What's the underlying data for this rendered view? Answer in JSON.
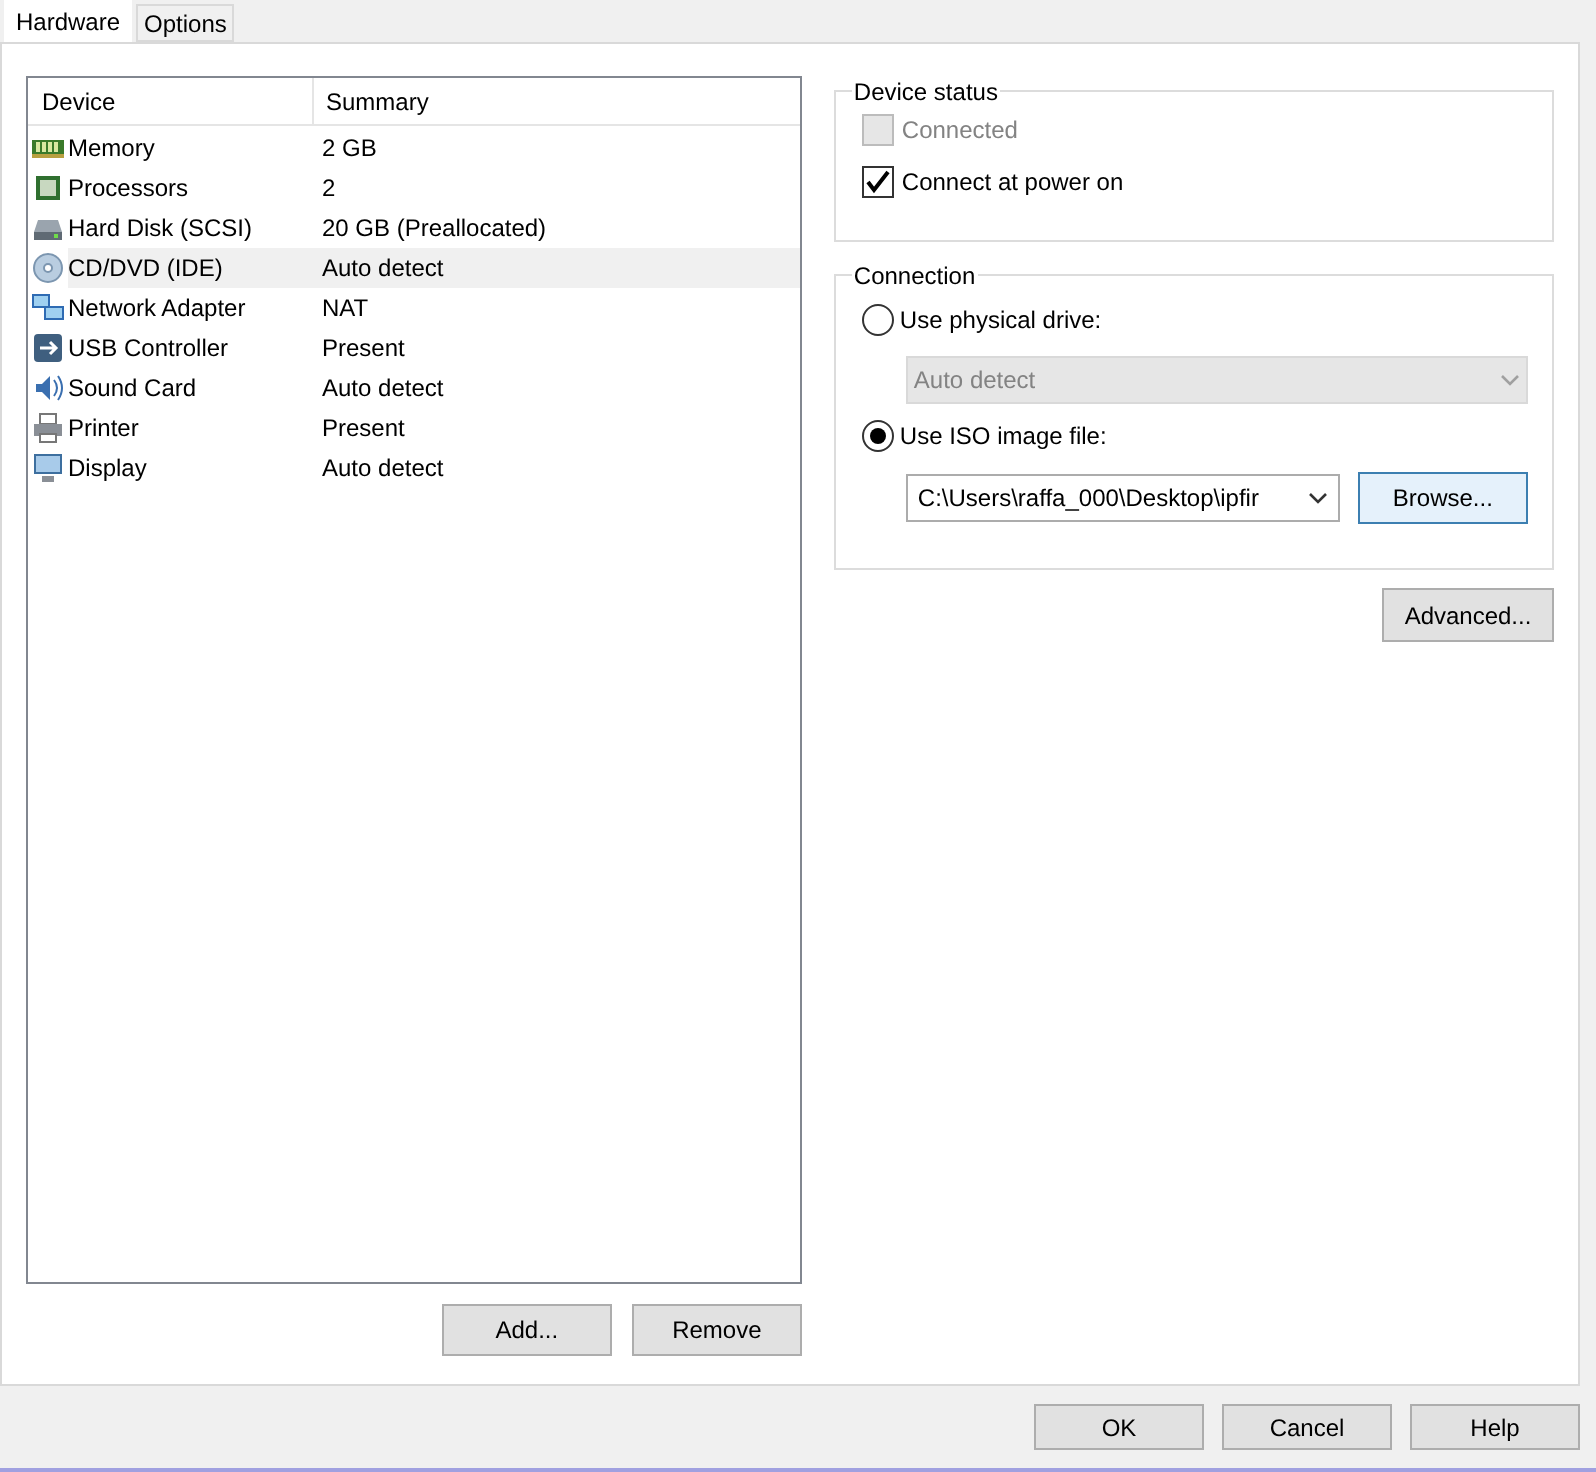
{
  "tabs": [
    {
      "label": "Hardware",
      "selected": true
    },
    {
      "label": "Options",
      "selected": false
    }
  ],
  "device_list": {
    "columns": [
      "Device",
      "Summary"
    ],
    "rows": [
      {
        "kind": "memory",
        "device": "Memory",
        "summary": "2 GB",
        "selected": false
      },
      {
        "kind": "processor",
        "device": "Processors",
        "summary": "2",
        "selected": false
      },
      {
        "kind": "disk",
        "device": "Hard Disk (SCSI)",
        "summary": "20 GB (Preallocated)",
        "selected": false
      },
      {
        "kind": "cd",
        "device": "CD/DVD (IDE)",
        "summary": "Auto detect",
        "selected": true
      },
      {
        "kind": "network",
        "device": "Network Adapter",
        "summary": "NAT",
        "selected": false
      },
      {
        "kind": "usb",
        "device": "USB Controller",
        "summary": "Present",
        "selected": false
      },
      {
        "kind": "sound",
        "device": "Sound Card",
        "summary": "Auto detect",
        "selected": false
      },
      {
        "kind": "printer",
        "device": "Printer",
        "summary": "Present",
        "selected": false
      },
      {
        "kind": "display",
        "device": "Display",
        "summary": "Auto detect",
        "selected": false
      }
    ]
  },
  "list_buttons": [
    "Add...",
    "Remove"
  ],
  "device_status": {
    "title": "Device status",
    "items": [
      {
        "label": "Connected",
        "checked": false,
        "disabled": true
      },
      {
        "label": "Connect at power on",
        "checked": true,
        "disabled": false
      }
    ]
  },
  "connection": {
    "title": "Connection",
    "physical_drive": {
      "label": "Use physical drive:",
      "selected": false,
      "value": "Auto detect",
      "disabled": true
    },
    "iso_file": {
      "label": "Use ISO image file:",
      "selected": true,
      "value": "C:\\Users\\raffa_000\\Desktop\\ipfir",
      "browse": "Browse..."
    }
  },
  "advanced_button": "Advanced...",
  "dialog_buttons": [
    "OK",
    "Cancel",
    "Help"
  ]
}
